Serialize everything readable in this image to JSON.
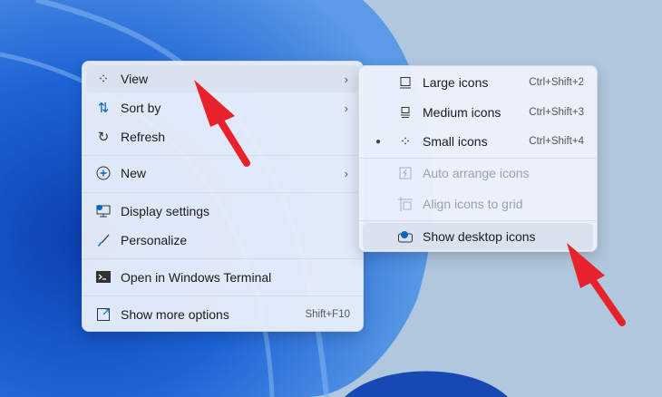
{
  "main_menu": {
    "items": [
      {
        "label": "View",
        "icon": "grid-icon",
        "submenu": true
      },
      {
        "label": "Sort by",
        "icon": "sort-arrows-icon",
        "submenu": true
      },
      {
        "label": "Refresh",
        "icon": "refresh-icon"
      },
      {
        "label": "New",
        "icon": "plus-circle-icon",
        "submenu": true
      },
      {
        "label": "Display settings",
        "icon": "display-settings-icon"
      },
      {
        "label": "Personalize",
        "icon": "brush-icon"
      },
      {
        "label": "Open in Windows Terminal",
        "icon": "terminal-icon"
      },
      {
        "label": "Show more options",
        "icon": "show-more-icon",
        "shortcut": "Shift+F10"
      }
    ]
  },
  "view_submenu": {
    "items": [
      {
        "label": "Large icons",
        "shortcut": "Ctrl+Shift+2"
      },
      {
        "label": "Medium icons",
        "shortcut": "Ctrl+Shift+3"
      },
      {
        "label": "Small icons",
        "shortcut": "Ctrl+Shift+4",
        "selected": true
      },
      {
        "label": "Auto arrange icons",
        "disabled": true
      },
      {
        "label": "Align icons to grid",
        "disabled": true
      },
      {
        "label": "Show desktop icons"
      }
    ]
  },
  "colors": {
    "arrow": "#e8222a",
    "accent": "#0067c0"
  }
}
